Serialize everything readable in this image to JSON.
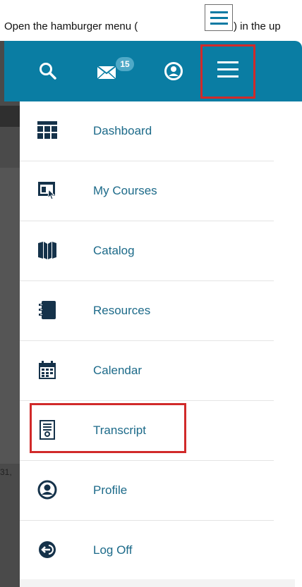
{
  "instruction": {
    "text_before": "Open the hamburger menu (",
    "text_after": ") in the up"
  },
  "topbar": {
    "icons": [
      "search-icon",
      "mail-icon",
      "user-circle-icon",
      "hamburger-icon"
    ],
    "mail_badge": "15",
    "color": "#0a7da3"
  },
  "menu": {
    "items": [
      {
        "label": "Dashboard",
        "icon": "dashboard-grid-icon"
      },
      {
        "label": "My Courses",
        "icon": "courses-icon"
      },
      {
        "label": "Catalog",
        "icon": "book-icon"
      },
      {
        "label": "Resources",
        "icon": "notebook-icon"
      },
      {
        "label": "Calendar",
        "icon": "calendar-icon"
      },
      {
        "label": "Transcript",
        "icon": "certificate-icon"
      },
      {
        "label": "Profile",
        "icon": "profile-icon"
      },
      {
        "label": "Log Off",
        "icon": "logoff-icon"
      }
    ],
    "highlight_color": "#d12a2a",
    "text_color": "#1c6a89"
  },
  "background": {
    "cut_text": "31,"
  }
}
